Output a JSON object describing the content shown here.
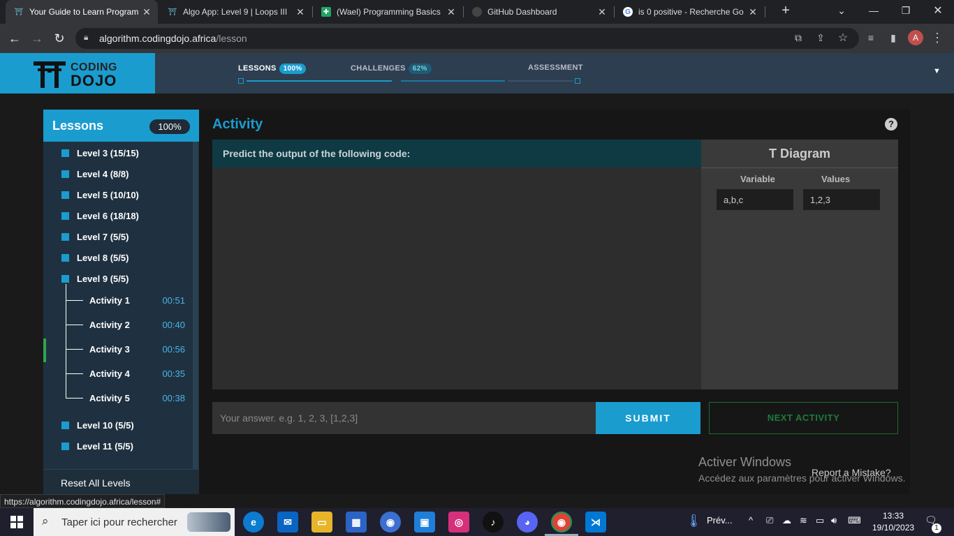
{
  "browser": {
    "tabs": [
      {
        "title": "Your Guide to Learn Program",
        "icon": "codingdojo-favicon",
        "active": true
      },
      {
        "title": "Algo App: Level 9 | Loops III",
        "icon": "codingdojo-favicon",
        "active": false
      },
      {
        "title": "(Wael) Programming Basics",
        "icon": "sheets-favicon",
        "active": false
      },
      {
        "title": "GitHub Dashboard",
        "icon": "github-favicon",
        "active": false
      },
      {
        "title": "is 0 positive - Recherche Go",
        "icon": "google-favicon",
        "active": false
      }
    ],
    "url_host": "algorithm.codingdojo.africa",
    "url_path": "/lesson",
    "profile_initial": "A",
    "status_url": "https://algorithm.codingdojo.africa/lesson#"
  },
  "site": {
    "logo_line1": "CODING",
    "logo_line2": "DOJO",
    "nav": [
      {
        "label": "LESSONS",
        "badge": "100%"
      },
      {
        "label": "CHALLENGES",
        "badge": "62%"
      },
      {
        "label": "ASSESSMENT",
        "badge": ""
      }
    ],
    "colors": {
      "accent": "#1a9ccf",
      "header": "#2c3e50",
      "green": "#2ea44f"
    }
  },
  "lessons": {
    "title": "Lessons",
    "progress": "100%",
    "levels_before": [
      "Level 3 (15/15)",
      "Level 4 (8/8)",
      "Level 5 (10/10)",
      "Level 6 (18/18)",
      "Level 7 (5/5)",
      "Level 8 (5/5)",
      "Level 9 (5/5)"
    ],
    "activities": [
      {
        "name": "Activity 1",
        "time": "00:51"
      },
      {
        "name": "Activity 2",
        "time": "00:40"
      },
      {
        "name": "Activity 3",
        "time": "00:56"
      },
      {
        "name": "Activity 4",
        "time": "00:35"
      },
      {
        "name": "Activity 5",
        "time": "00:38"
      }
    ],
    "current_activity": "Activity 3",
    "levels_after": [
      "Level 10 (5/5)",
      "Level 11 (5/5)"
    ],
    "reset_label": "Reset All Levels"
  },
  "activity": {
    "title": "Activity",
    "prompt": "Predict the output of the following code:",
    "t_diagram": {
      "title": "T Diagram",
      "variable_header": "Variable",
      "values_header": "Values",
      "variable": "a,b,c",
      "values": "1,2,3"
    },
    "answer_placeholder": "Your answer. e.g. 1, 2, 3, [1,2,3]",
    "submit_label": "SUBMIT",
    "next_label": "NEXT ACTIVITY",
    "report_label": "Report a Mistake?"
  },
  "watermark": {
    "line1": "Activer Windows",
    "line2": "Accédez aux paramètres pour activer Windows."
  },
  "taskbar": {
    "search_placeholder": "Taper ici pour rechercher",
    "weather": "Prév...",
    "time": "13:33",
    "date": "19/10/2023",
    "notifications": "1"
  }
}
